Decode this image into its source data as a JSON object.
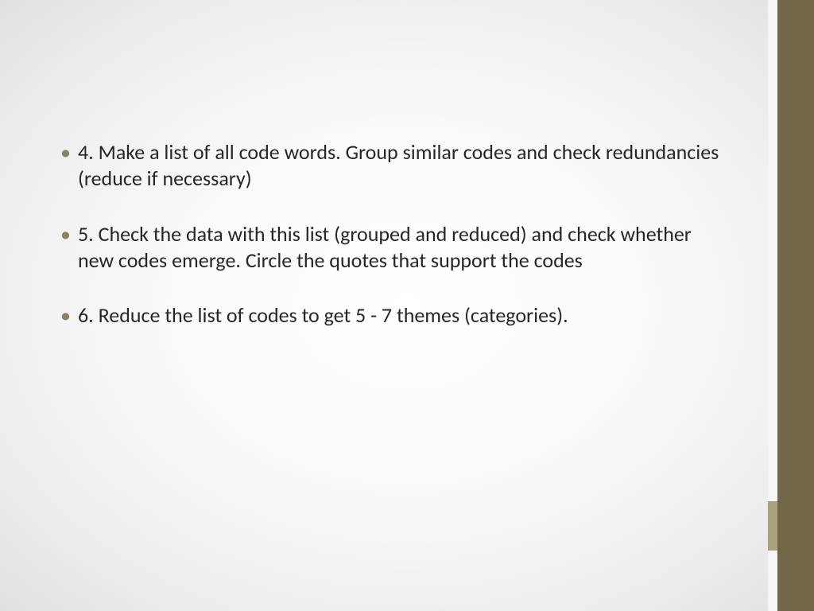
{
  "slide": {
    "bullets": [
      "4. Make a list of all code words. Group similar codes and check redundancies (reduce if necessary)",
      "5. Check the data with this list (grouped and reduced) and check whether new codes emerge. Circle the quotes that support the codes",
      "6. Reduce the list of codes to get 5 - 7 themes (categories)."
    ]
  },
  "theme": {
    "sidebar_color": "#6f6748",
    "accent_color": "#a9a07c",
    "bullet_color": "#8a8265"
  }
}
